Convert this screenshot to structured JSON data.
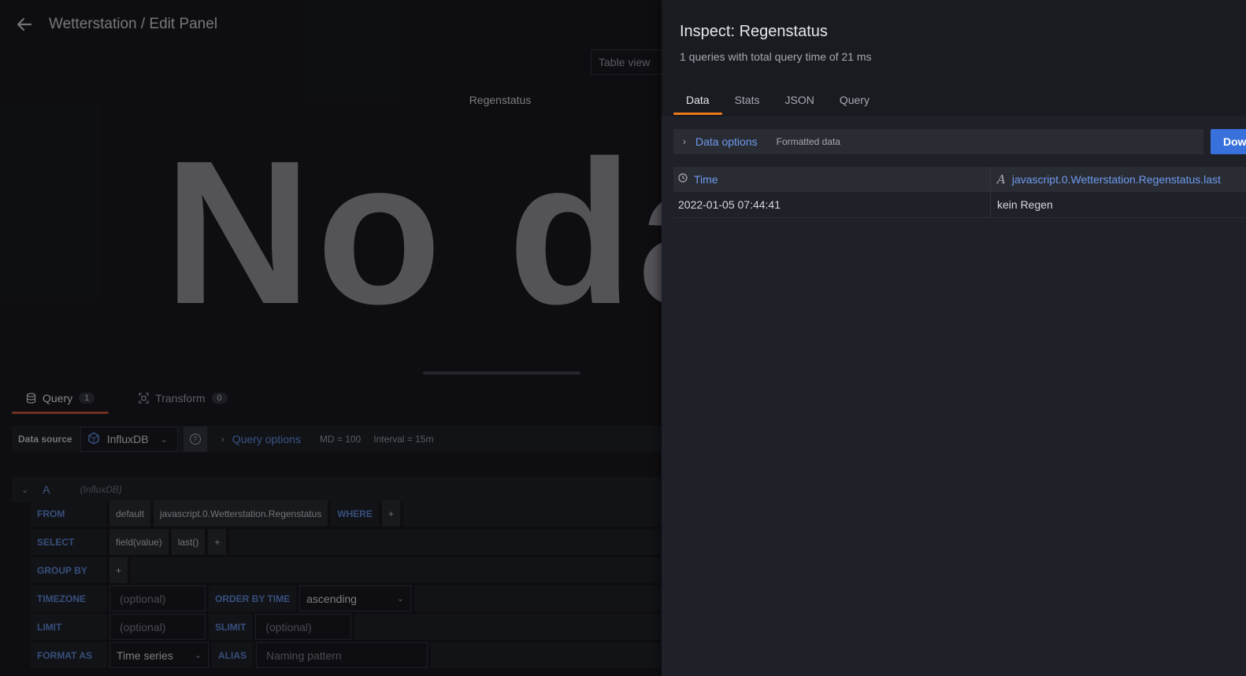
{
  "header": {
    "title": "Wetterstation / Edit Panel"
  },
  "panel": {
    "view_toggle_label": "Table view",
    "title": "Regenstatus",
    "no_data_text": "No da"
  },
  "query_tabs": [
    {
      "label": "Query",
      "count": "1"
    },
    {
      "label": "Transform",
      "count": "0"
    }
  ],
  "datasource": {
    "label": "Data source",
    "selected": "InfluxDB",
    "help": "?",
    "query_options_label": "Query options",
    "md": "MD = 100",
    "interval": "Interval = 15m"
  },
  "query_a": {
    "letter": "A",
    "source": "(InfluxDB)",
    "from_kw": "FROM",
    "from_policy": "default",
    "from_measurement": "javascript.0.Wetterstation.Regenstatus",
    "where_kw": "WHERE",
    "plus": "+",
    "select_kw": "SELECT",
    "select_field": "field(value)",
    "select_fn": "last()",
    "groupby_kw": "GROUP BY",
    "timezone_kw": "TIMEZONE",
    "timezone_placeholder": "(optional)",
    "orderby_kw": "ORDER BY TIME",
    "orderby_value": "ascending",
    "limit_kw": "LIMIT",
    "limit_placeholder": "(optional)",
    "slimit_kw": "SLIMIT",
    "slimit_placeholder": "(optional)",
    "format_kw": "FORMAT AS",
    "format_value": "Time series",
    "alias_kw": "ALIAS",
    "alias_placeholder": "Naming pattern"
  },
  "inspect": {
    "title": "Inspect: Regenstatus",
    "subtitle": "1 queries with total query time of 21 ms",
    "tabs": [
      "Data",
      "Stats",
      "JSON",
      "Query"
    ],
    "data_options_label": "Data options",
    "data_options_meta": "Formatted data",
    "download_label": "Down",
    "columns": [
      "Time",
      "javascript.0.Wetterstation.Regenstatus.last"
    ],
    "rows": [
      [
        "2022-01-05 07:44:41",
        "kein Regen"
      ]
    ]
  },
  "colors": {
    "accent_query_tab": "#c44f33",
    "accent_inspect_tab": "#eb7b18",
    "download_button": "#3871dc",
    "link_blue": "#6e9bf0"
  }
}
